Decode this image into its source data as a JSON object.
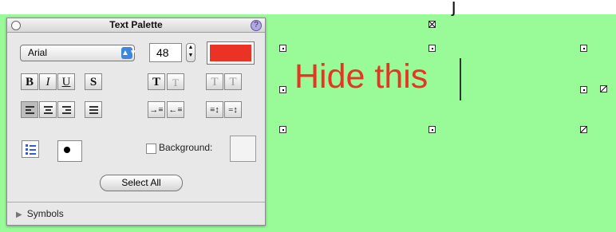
{
  "page": {
    "top_fragment": "j"
  },
  "palette": {
    "title": "Text Palette",
    "help_label": "?",
    "font": "Arial",
    "size": "48",
    "select_all": "Select All",
    "background_label": "Background:",
    "symbols_label": "Symbols",
    "buttons": {
      "bold": "B",
      "italic": "I",
      "underline": "U",
      "shadow": "S",
      "bigger": "T",
      "smaller": "T",
      "superscript": "T",
      "subscript": "T"
    },
    "colors": {
      "text_color": "#ea3325",
      "background": "#98fb98"
    }
  },
  "canvas": {
    "text": "Hide this"
  }
}
